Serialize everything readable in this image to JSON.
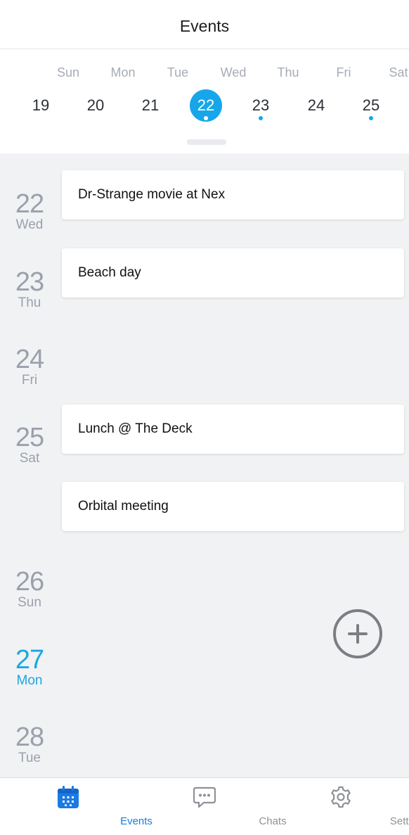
{
  "header": {
    "title": "Events"
  },
  "week_strip": {
    "days": [
      {
        "name": "Sun",
        "num": "19",
        "selected": false,
        "has_events": false
      },
      {
        "name": "Mon",
        "num": "20",
        "selected": false,
        "has_events": false
      },
      {
        "name": "Tue",
        "num": "21",
        "selected": false,
        "has_events": false
      },
      {
        "name": "Wed",
        "num": "22",
        "selected": true,
        "has_events": true
      },
      {
        "name": "Thu",
        "num": "23",
        "selected": false,
        "has_events": true
      },
      {
        "name": "Fri",
        "num": "24",
        "selected": false,
        "has_events": false
      },
      {
        "name": "Sat",
        "num": "25",
        "selected": false,
        "has_events": true
      }
    ]
  },
  "timeline": {
    "days": [
      {
        "num": "22",
        "weekday": "Wed",
        "today": false
      },
      {
        "num": "23",
        "weekday": "Thu",
        "today": false
      },
      {
        "num": "24",
        "weekday": "Fri",
        "today": false
      },
      {
        "num": "25",
        "weekday": "Sat",
        "today": false
      },
      {
        "num": "26",
        "weekday": "Sun",
        "today": false
      },
      {
        "num": "27",
        "weekday": "Mon",
        "today": true
      },
      {
        "num": "28",
        "weekday": "Tue",
        "today": false
      }
    ],
    "events": [
      {
        "title": "Dr-Strange movie at Nex",
        "day": "22"
      },
      {
        "title": "Beach day",
        "day": "23"
      },
      {
        "title": "Lunch @ The Deck",
        "day": "25"
      },
      {
        "title": "Orbital meeting",
        "day": "25"
      }
    ]
  },
  "fab": {
    "icon": "plus-icon"
  },
  "tabbar": {
    "tabs": [
      {
        "label": "Events",
        "icon": "calendar-icon",
        "active": true
      },
      {
        "label": "Chats",
        "icon": "chat-icon",
        "active": false
      },
      {
        "label": "Settings",
        "icon": "gear-icon",
        "active": false
      }
    ]
  },
  "colors": {
    "accent": "#16a6e9",
    "tab_active": "#1a7be3",
    "muted": "#9aa1ac",
    "timeline_bg": "#f1f2f4"
  }
}
